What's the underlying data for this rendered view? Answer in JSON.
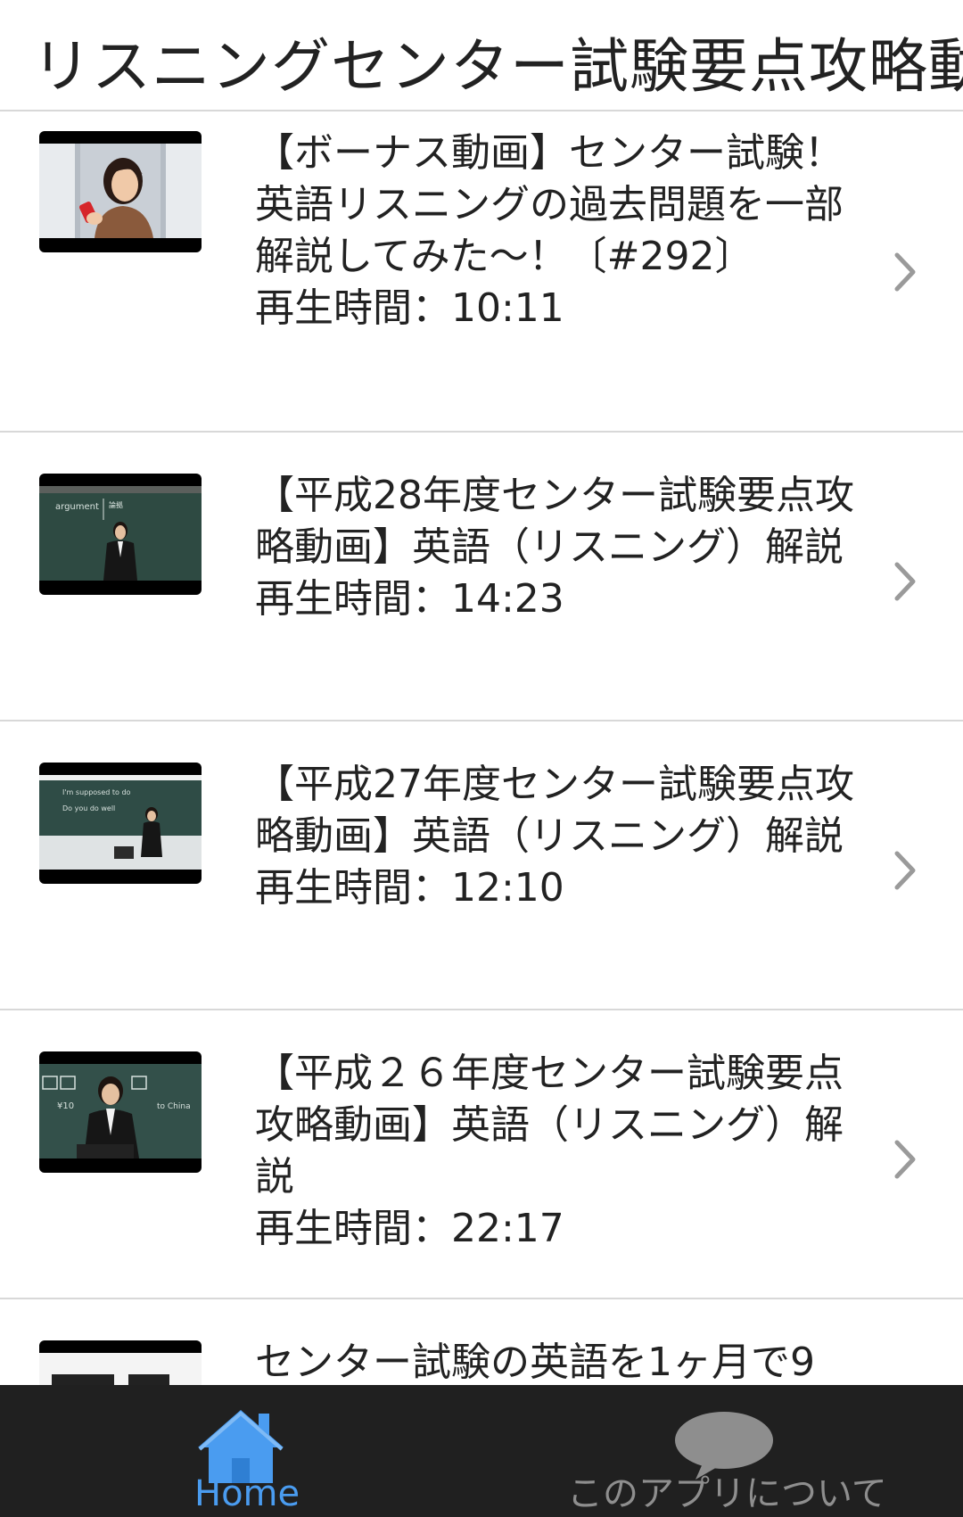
{
  "header": {
    "title": "リスニングセンター試験要点攻略動画"
  },
  "videos": [
    {
      "title": "【ボーナス動画】センター試験！英語リスニングの過去問題を一部解説してみた～！〔#292〕",
      "duration_label": "再生時間：10:11",
      "thumbnail": "woman-holding-phone"
    },
    {
      "title": "【平成28年度センター試験要点攻略動画】英語（リスニング）解説",
      "duration_label": "再生時間：14:23",
      "thumbnail": "lecturer-at-blackboard"
    },
    {
      "title": "【平成27年度センター試験要点攻略動画】英語（リスニング）解説",
      "duration_label": "再生時間：12:10",
      "thumbnail": "lecturer-in-classroom"
    },
    {
      "title": "【平成２６年度センター試験要点攻略動画】英語（リスニング）解説",
      "duration_label": "再生時間：22:17",
      "thumbnail": "lecturer-close-up"
    },
    {
      "title": "センター試験の英語を1ヶ月で9",
      "duration_label": "",
      "thumbnail": "text-slide"
    }
  ],
  "tabbar": {
    "home": {
      "label": "Home",
      "icon": "home-icon",
      "active": true
    },
    "about": {
      "label": "このアプリについて",
      "icon": "speech-bubble-icon",
      "active": false
    }
  },
  "colors": {
    "accent": "#4a9cf0",
    "tabbar_bg": "#202020",
    "inactive_tab": "#8e8e8e",
    "divider": "#d8d8d8",
    "chevron": "#9a9a9a"
  }
}
